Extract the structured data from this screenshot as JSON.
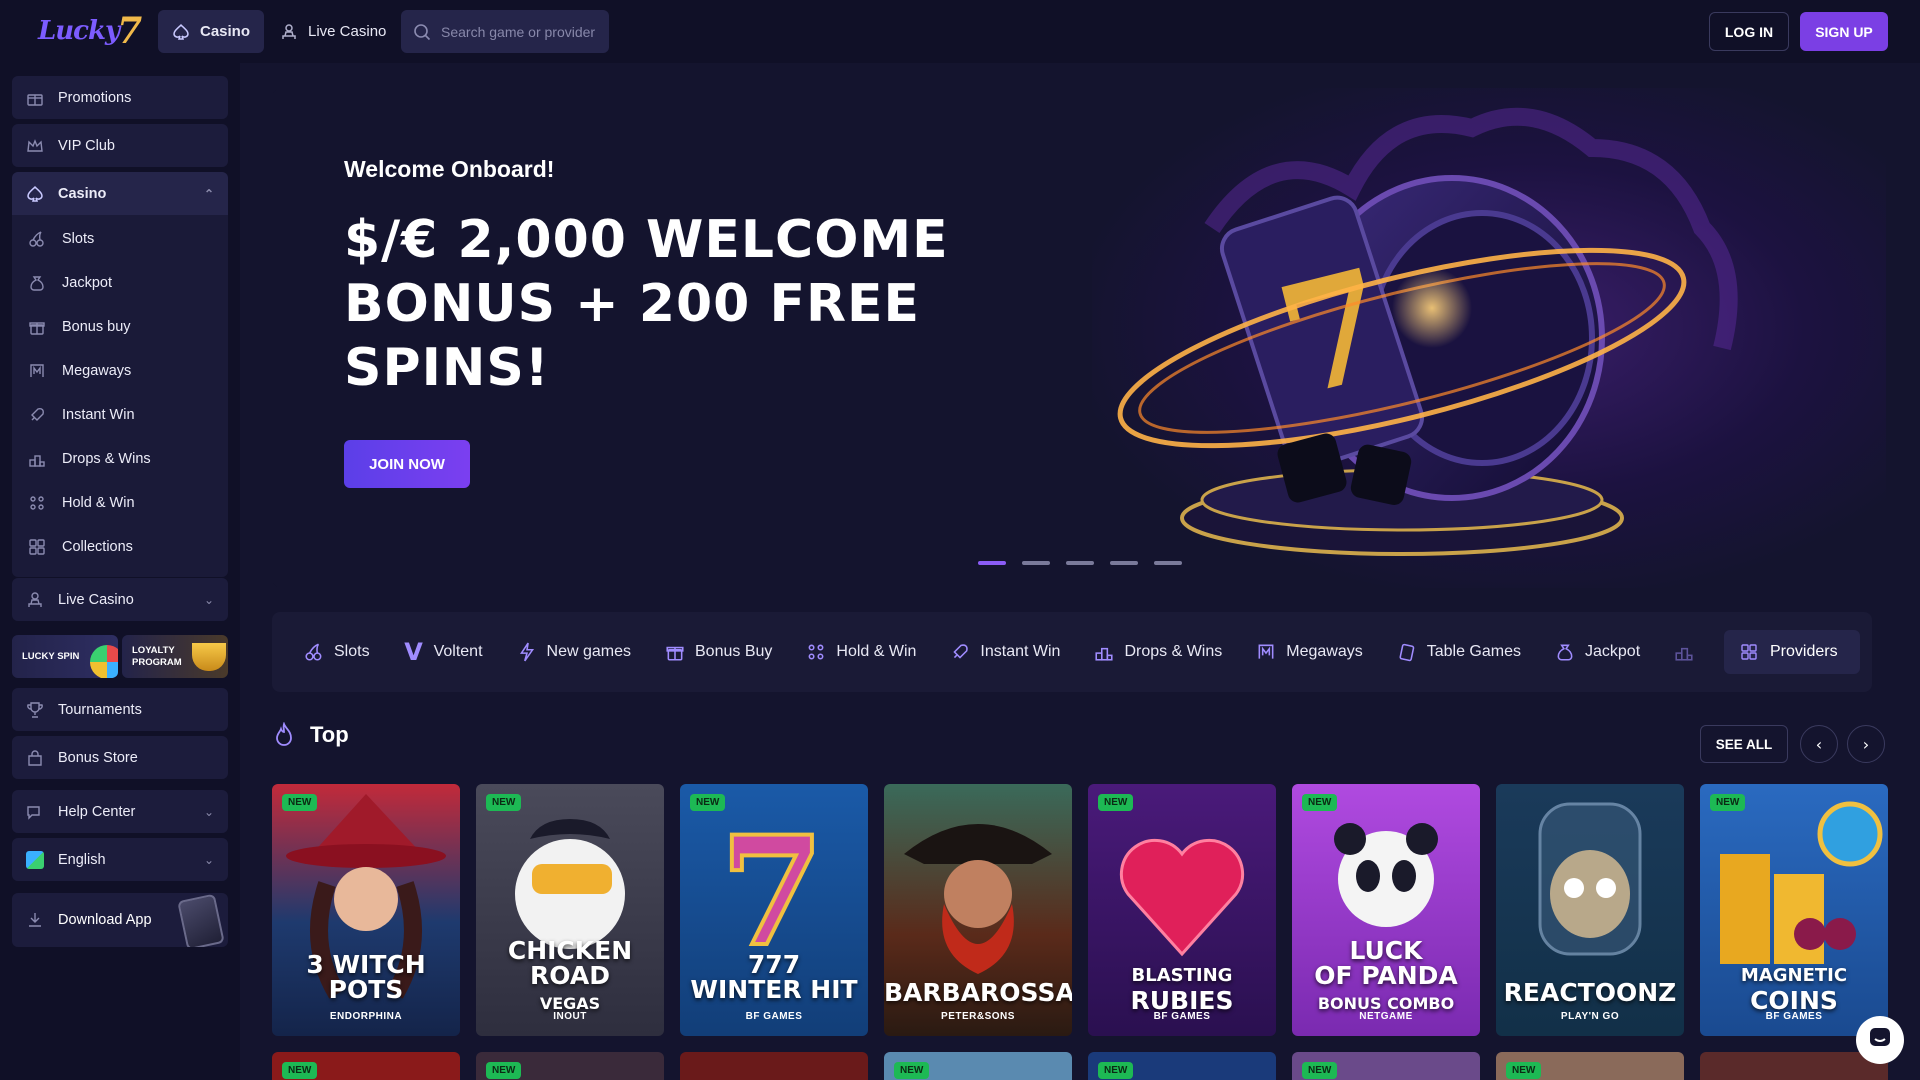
{
  "header": {
    "logo_text": "Lucky",
    "logo_seven": "7",
    "tabs": [
      {
        "label": "Casino",
        "icon": "spade-icon"
      },
      {
        "label": "Live Casino",
        "icon": "dealer-icon"
      }
    ],
    "search_placeholder": "Search game or provider",
    "login_label": "LOG IN",
    "signup_label": "SIGN UP"
  },
  "sidebar": {
    "items": [
      {
        "label": "Promotions",
        "icon": "gift-icon"
      },
      {
        "label": "VIP Club",
        "icon": "crown-icon"
      },
      {
        "label": "Casino",
        "icon": "spade-icon",
        "expanded": true
      }
    ],
    "casino_sub": [
      {
        "label": "Slots",
        "icon": "cherries-icon"
      },
      {
        "label": "Jackpot",
        "icon": "money-bag-icon"
      },
      {
        "label": "Bonus buy",
        "icon": "gift-box-icon"
      },
      {
        "label": "Megaways",
        "icon": "m-icon"
      },
      {
        "label": "Instant Win",
        "icon": "rocket-icon"
      },
      {
        "label": "Drops & Wins",
        "icon": "podium-icon"
      },
      {
        "label": "Hold & Win",
        "icon": "grid-dots-icon"
      },
      {
        "label": "Collections",
        "icon": "collections-icon"
      }
    ],
    "live_casino": "Live Casino",
    "lucky_spin": "LUCKY SPIN",
    "loyalty_line1": "LOYALTY",
    "loyalty_line2": "PROGRAM",
    "tournaments": "Tournaments",
    "bonus_store": "Bonus Store",
    "help_center": "Help Center",
    "language": "English",
    "download_app": "Download App"
  },
  "hero": {
    "welcome": "Welcome Onboard!",
    "title": "$/€ 2,000 WELCOME BONUS + 200 FREE SPINS!",
    "join_label": "JOIN NOW",
    "slides": 5,
    "active_slide": 1
  },
  "categories": [
    {
      "label": "Slots",
      "icon": "cherries-icon"
    },
    {
      "label": "Voltent",
      "icon": "voltent-v-icon"
    },
    {
      "label": "New games",
      "icon": "lightning-icon"
    },
    {
      "label": "Bonus Buy",
      "icon": "gift-box-icon"
    },
    {
      "label": "Hold & Win",
      "icon": "grid-dots-icon"
    },
    {
      "label": "Instant Win",
      "icon": "rocket-icon"
    },
    {
      "label": "Drops & Wins",
      "icon": "podium-icon"
    },
    {
      "label": "Megaways",
      "icon": "m-icon"
    },
    {
      "label": "Table Games",
      "icon": "cards-icon"
    },
    {
      "label": "Jackpot",
      "icon": "money-bag-icon"
    }
  ],
  "providers_label": "Providers",
  "top_section": {
    "title": "Top",
    "see_all": "SEE ALL",
    "new_badge": "NEW",
    "games": [
      {
        "title_lines": [
          "3 WITCH",
          "POTS"
        ],
        "provider": "ENDORPHINA",
        "new": true,
        "bg": "#1e3a6e"
      },
      {
        "title_lines": [
          "CHICKEN",
          "ROAD",
          "VEGAS"
        ],
        "provider": "INOUT",
        "new": true,
        "bg": "#3a3a4a"
      },
      {
        "title_lines": [
          "777",
          "WINTER HIT"
        ],
        "provider": "BF GAMES",
        "new": true,
        "bg": "#1a4a8a"
      },
      {
        "title_lines": [
          "BARBAROSSA"
        ],
        "provider": "PETER&SONS",
        "new": false,
        "bg": "#2a4a3a"
      },
      {
        "title_lines": [
          "BLASTING",
          "RUBIES"
        ],
        "provider": "BF GAMES",
        "new": true,
        "bg": "#3a1a5a"
      },
      {
        "title_lines": [
          "LUCK",
          "OF PANDA",
          "BONUS COMBO"
        ],
        "provider": "NETGAME",
        "new": true,
        "bg": "#7a3ab0"
      },
      {
        "title_lines": [
          "REACTOONZ"
        ],
        "provider": "PLAY'N GO",
        "new": false,
        "bg": "#1a3a5a"
      },
      {
        "title_lines": [
          "MAGNETIC",
          "COINS"
        ],
        "provider": "BF GAMES",
        "new": true,
        "bg": "#2a5aa0"
      }
    ]
  },
  "colors": {
    "bg": "#14142e",
    "panel": "#1a1a36",
    "accent": "#7b3fe4",
    "new_badge": "#1db954"
  }
}
